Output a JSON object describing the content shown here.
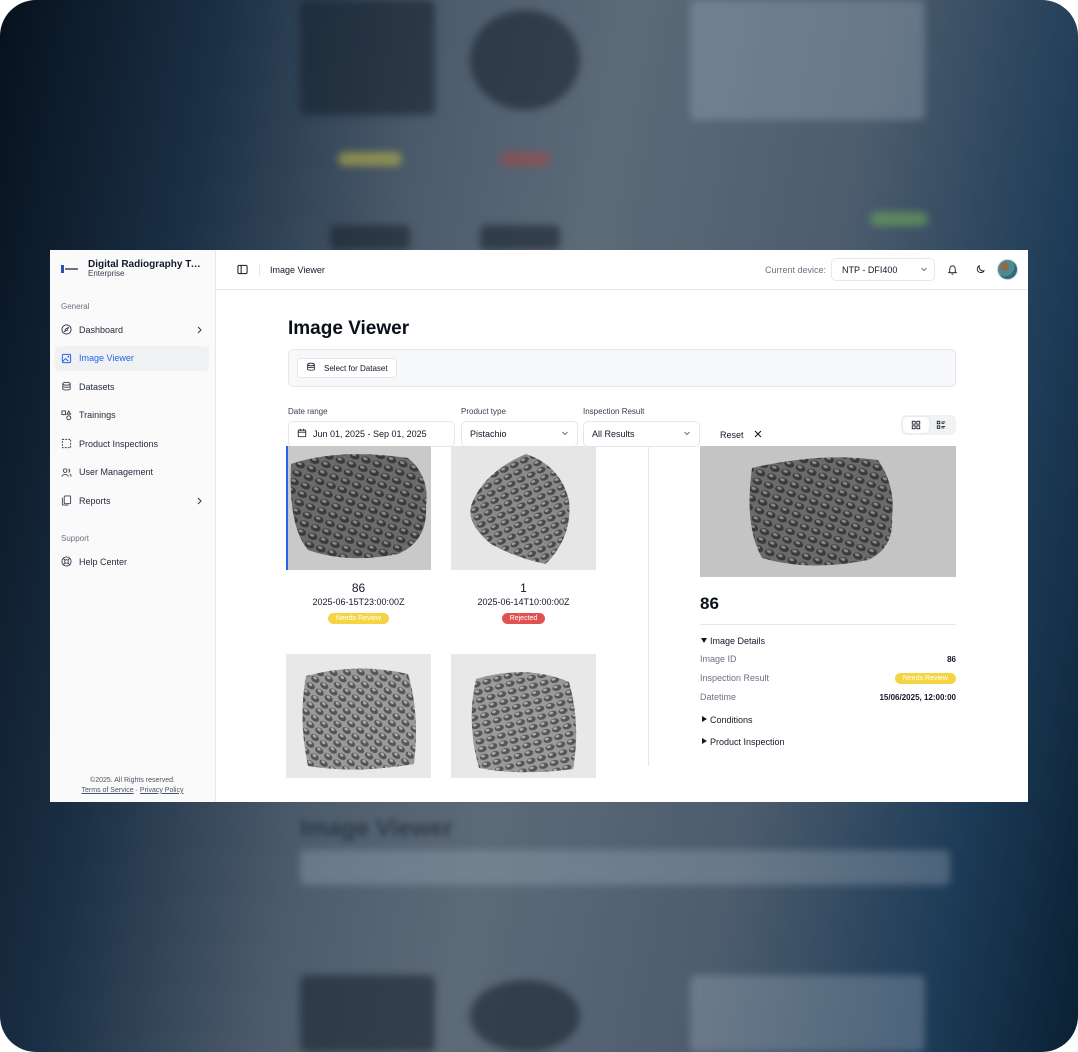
{
  "sidebar": {
    "brand_name": "Digital Radiography Tech...",
    "brand_sub": "Enterprise",
    "group_general": "General",
    "items": [
      {
        "label": "Dashboard",
        "icon": "compass-icon"
      },
      {
        "label": "Image Viewer",
        "icon": "image-icon"
      },
      {
        "label": "Datasets",
        "icon": "database-icon"
      },
      {
        "label": "Trainings",
        "icon": "shapes-icon"
      },
      {
        "label": "Product Inspections",
        "icon": "scan-icon"
      },
      {
        "label": "User Management",
        "icon": "users-icon"
      },
      {
        "label": "Reports",
        "icon": "file-copy-icon"
      }
    ],
    "group_support": "Support",
    "support_items": [
      {
        "label": "Help Center",
        "icon": "lifebuoy-icon"
      }
    ],
    "footer_copyright": "©2025. All Rights reserved.",
    "footer_terms": "Terms of Service",
    "footer_sep": "·",
    "footer_privacy": "Privacy Policy"
  },
  "topbar": {
    "breadcrumb": "Image Viewer",
    "device_label": "Current device:",
    "device_value": "NTP - DFI400"
  },
  "page": {
    "title": "Image Viewer",
    "select_dataset": "Select for Dataset"
  },
  "filters": {
    "date_label": "Date range",
    "date_value": "Jun 01, 2025 - Sep 01, 2025",
    "product_label": "Product type",
    "product_value": "Pistachio",
    "result_label": "Inspection Result",
    "result_value": "All Results",
    "reset": "Reset"
  },
  "gallery": [
    {
      "id": "86",
      "date": "2025-06-15T23:00:00Z",
      "badge": "Needs Review"
    },
    {
      "id": "1",
      "date": "2025-06-14T10:00:00Z",
      "badge": "Rejected"
    }
  ],
  "detail": {
    "id": "86",
    "image_details": "Image Details",
    "image_id_label": "Image ID",
    "image_id_value": "86",
    "result_label": "Inspection Result",
    "result_value": "Needs Review",
    "datetime_label": "Datetime",
    "datetime_value": "15/06/2025, 12:00:00",
    "conditions": "Conditions",
    "product_inspection": "Product Inspection"
  },
  "colors": {
    "accent": "#2563eb",
    "needs_review": "#f5d442",
    "rejected": "#e05252"
  }
}
